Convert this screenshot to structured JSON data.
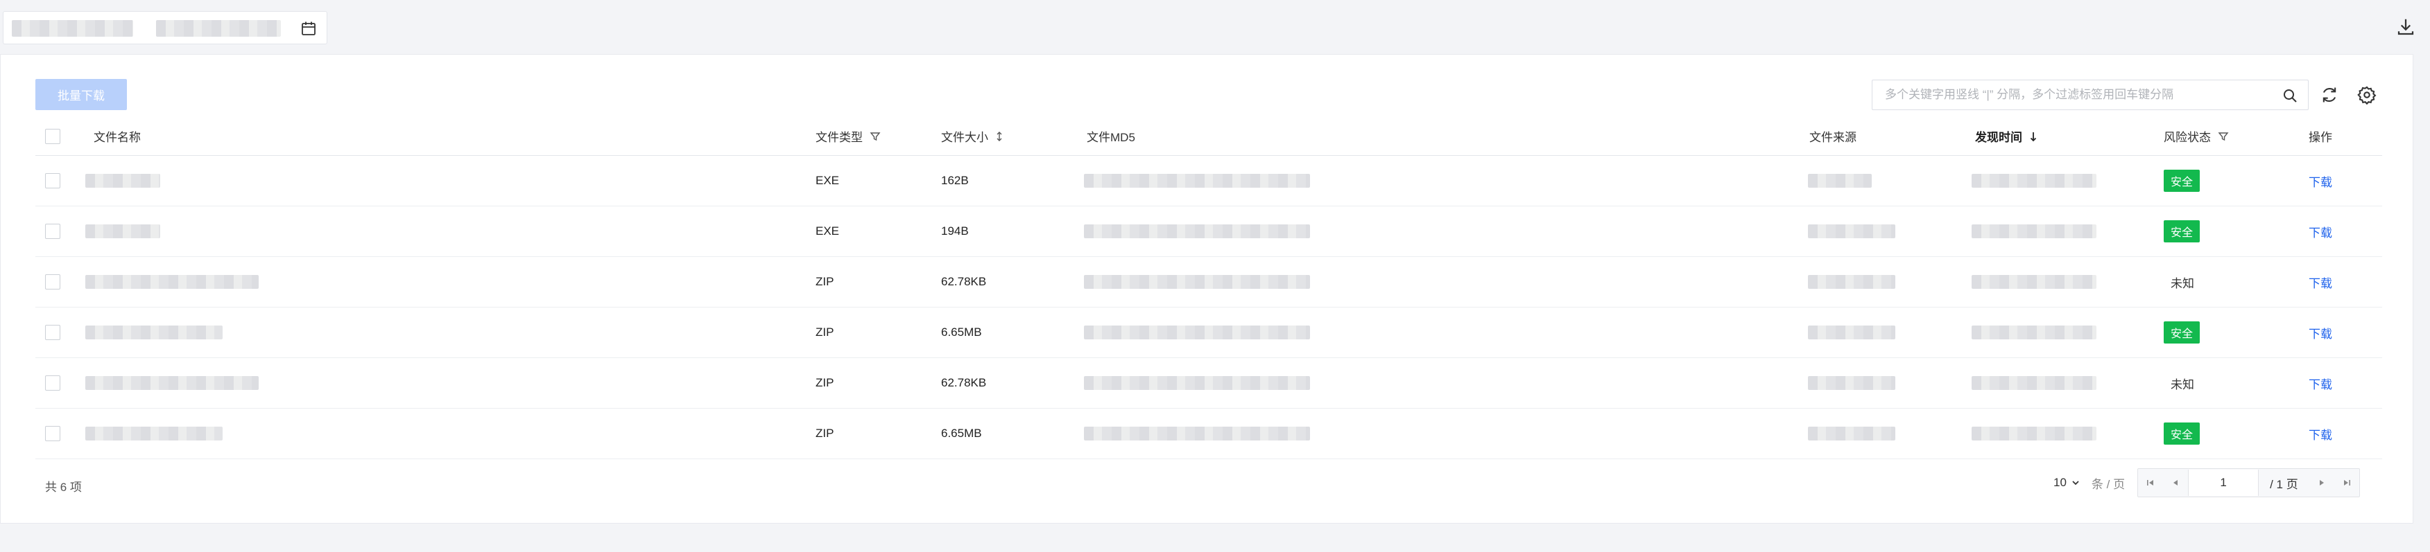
{
  "toolbar": {
    "bulk_download_label": "批量下载"
  },
  "search": {
    "placeholder": "多个关键字用竖线 “|” 分隔，多个过滤标签用回车键分隔"
  },
  "table": {
    "columns": {
      "name": "文件名称",
      "type": "文件类型",
      "size": "文件大小",
      "md5": "文件MD5",
      "source": "文件来源",
      "found_time": "发现时间",
      "risk": "风险状态",
      "action": "操作"
    },
    "rows": [
      {
        "type": "EXE",
        "size": "162B",
        "risk": "安全",
        "action": "下载"
      },
      {
        "type": "EXE",
        "size": "194B",
        "risk": "安全",
        "action": "下载"
      },
      {
        "type": "ZIP",
        "size": "62.78KB",
        "risk": "未知",
        "action": "下载"
      },
      {
        "type": "ZIP",
        "size": "6.65MB",
        "risk": "安全",
        "action": "下载"
      },
      {
        "type": "ZIP",
        "size": "62.78KB",
        "risk": "未知",
        "action": "下载"
      },
      {
        "type": "ZIP",
        "size": "6.65MB",
        "risk": "安全",
        "action": "下载"
      }
    ]
  },
  "footer": {
    "total": "共 6 项",
    "page_size": "10",
    "page_size_unit": "条 / 页",
    "current_page": "1",
    "page_total": "/ 1 页"
  },
  "colors": {
    "accent": "#1e62ec",
    "safe": "#13b94e",
    "bulk_button": "#b8d0fb"
  },
  "icons": [
    "calendar-icon",
    "download-icon",
    "search-icon",
    "refresh-icon",
    "gear-icon",
    "filter-icon",
    "sort-icon",
    "arrow-down-icon",
    "chevron-down-icon",
    "first-page-icon",
    "prev-page-icon",
    "next-page-icon",
    "last-page-icon"
  ]
}
